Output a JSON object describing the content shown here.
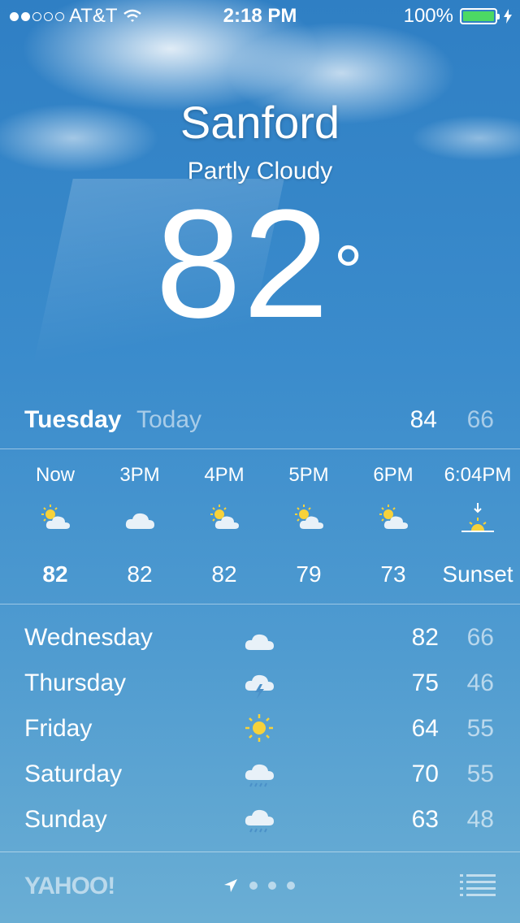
{
  "status_bar": {
    "carrier": "AT&T",
    "time": "2:18 PM",
    "battery_percent": "100%",
    "signal_bars_filled": 2,
    "signal_bars_total": 5
  },
  "location": {
    "city": "Sanford",
    "condition": "Partly Cloudy",
    "temperature": "82",
    "degree_symbol": "°"
  },
  "today": {
    "day": "Tuesday",
    "label": "Today",
    "high": "84",
    "low": "66"
  },
  "hourly": [
    {
      "time": "Now",
      "icon": "partly-cloudy-icon",
      "value": "82"
    },
    {
      "time": "3PM",
      "icon": "cloud-icon",
      "value": "82"
    },
    {
      "time": "4PM",
      "icon": "partly-cloudy-icon",
      "value": "82"
    },
    {
      "time": "5PM",
      "icon": "partly-cloudy-icon",
      "value": "79"
    },
    {
      "time": "6PM",
      "icon": "partly-cloudy-icon",
      "value": "73"
    },
    {
      "time": "6:04PM",
      "icon": "sunset-icon",
      "value": "Sunset"
    }
  ],
  "daily": [
    {
      "day": "Wednesday",
      "icon": "cloud-icon",
      "high": "82",
      "low": "66"
    },
    {
      "day": "Thursday",
      "icon": "thunderstorm-icon",
      "high": "75",
      "low": "46"
    },
    {
      "day": "Friday",
      "icon": "sun-icon",
      "high": "64",
      "low": "55"
    },
    {
      "day": "Saturday",
      "icon": "rain-icon",
      "high": "70",
      "low": "55"
    },
    {
      "day": "Sunday",
      "icon": "rain-icon",
      "high": "63",
      "low": "48"
    }
  ],
  "footer": {
    "provider": "YAHOO!",
    "page_count": 3
  },
  "colors": {
    "sun": "#f7d23a",
    "battery": "#4cd964",
    "sky_top": "#2f7fc4",
    "sky_bottom": "#6aaed4"
  }
}
